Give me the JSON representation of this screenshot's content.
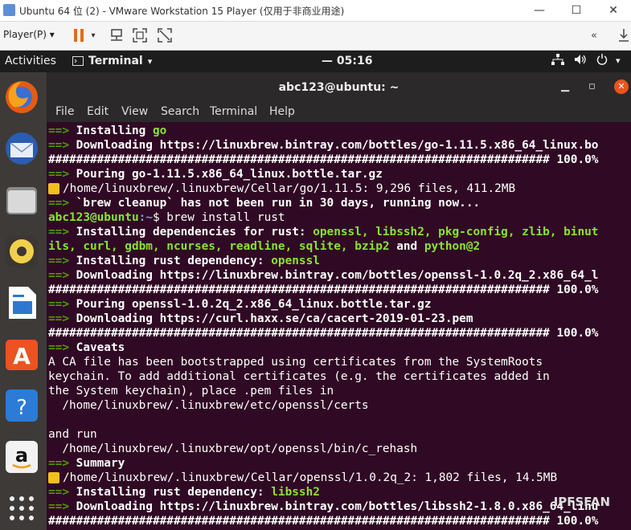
{
  "vm": {
    "title": "Ubuntu 64 位 (2) - VMware Workstation 15 Player (仅用于非商业用途)",
    "player_menu": "Player(P)",
    "minimize": "—",
    "maximize": "☐",
    "close": "✕"
  },
  "topbar": {
    "activities": "Activities",
    "app_name": "Terminal",
    "clock": "— 05:16"
  },
  "terminal": {
    "title": "abc123@ubuntu: ~",
    "menu": [
      "File",
      "Edit",
      "View",
      "Search",
      "Terminal",
      "Help"
    ],
    "lines": [
      {
        "type": "arrow",
        "bold": "Installing ",
        "green": "go"
      },
      {
        "type": "arrow",
        "bold": "Downloading https://linuxbrew.bintray.com/bottles/go-1.11.5.x86_64_linux.bo"
      },
      {
        "type": "hash",
        "text": "######################################################################## 100.0%"
      },
      {
        "type": "arrow",
        "bold": "Pouring go-1.11.5.x86_64_linux.bottle.tar.gz"
      },
      {
        "type": "beer",
        "text": "/home/linuxbrew/.linuxbrew/Cellar/go/1.11.5: 9,296 files, 411.2MB"
      },
      {
        "type": "arrow",
        "bold": "`brew cleanup` has not been run in 30 days, running now..."
      },
      {
        "type": "prompt",
        "user": "abc123@ubuntu",
        "path": ":~",
        "cmd": "$ brew install rust"
      },
      {
        "type": "arrow",
        "bold": "Installing dependencies for rust: ",
        "green": "openssl, libssh2, pkg-config, zlib, binut"
      },
      {
        "type": "cont",
        "green": "ils, curl, gdbm, ncurses, readline, sqlite, bzip2",
        "bold": " and ",
        "green2": "python@2"
      },
      {
        "type": "arrow",
        "bold": "Installing rust dependency: ",
        "green": "openssl"
      },
      {
        "type": "arrow",
        "bold": "Downloading https://linuxbrew.bintray.com/bottles/openssl-1.0.2q_2.x86_64_l"
      },
      {
        "type": "hash",
        "text": "######################################################################## 100.0%"
      },
      {
        "type": "arrow",
        "bold": "Pouring openssl-1.0.2q_2.x86_64_linux.bottle.tar.gz"
      },
      {
        "type": "arrow",
        "bold": "Downloading https://curl.haxx.se/ca/cacert-2019-01-23.pem"
      },
      {
        "type": "hash",
        "text": "######################################################################## 100.0%"
      },
      {
        "type": "arrow",
        "bold": "Caveats"
      },
      {
        "type": "plain",
        "text": "A CA file has been bootstrapped using certificates from the SystemRoots"
      },
      {
        "type": "plain",
        "text": "keychain. To add additional certificates (e.g. the certificates added in"
      },
      {
        "type": "plain",
        "text": "the System keychain), place .pem files in"
      },
      {
        "type": "plain",
        "text": "  /home/linuxbrew/.linuxbrew/etc/openssl/certs"
      },
      {
        "type": "plain",
        "text": ""
      },
      {
        "type": "plain",
        "text": "and run"
      },
      {
        "type": "plain",
        "text": "  /home/linuxbrew/.linuxbrew/opt/openssl/bin/c_rehash"
      },
      {
        "type": "arrow",
        "bold": "Summary"
      },
      {
        "type": "beer",
        "text": "/home/linuxbrew/.linuxbrew/Cellar/openssl/1.0.2q_2: 1,802 files, 14.5MB"
      },
      {
        "type": "arrow",
        "bold": "Installing rust dependency: ",
        "green": "libssh2"
      },
      {
        "type": "arrow",
        "bold": "Downloading https://linuxbrew.bintray.com/bottles/libssh2-1.8.0.x86_64_linu"
      },
      {
        "type": "hash",
        "text": "######################################################################## 100.0%"
      }
    ]
  },
  "dock": {
    "apps": [
      "firefox-icon",
      "thunderbird-icon",
      "files-icon",
      "rhythmbox-icon",
      "writer-icon",
      "software-icon",
      "help-icon",
      "amazon-icon",
      "show-apps-icon"
    ]
  },
  "watermark": "IPFSFAN",
  "colors": {
    "terminal_bg": "#300a24",
    "arrow_green": "#4e9a06",
    "bright_green": "#8ae234",
    "ubuntu_orange": "#e95420"
  }
}
